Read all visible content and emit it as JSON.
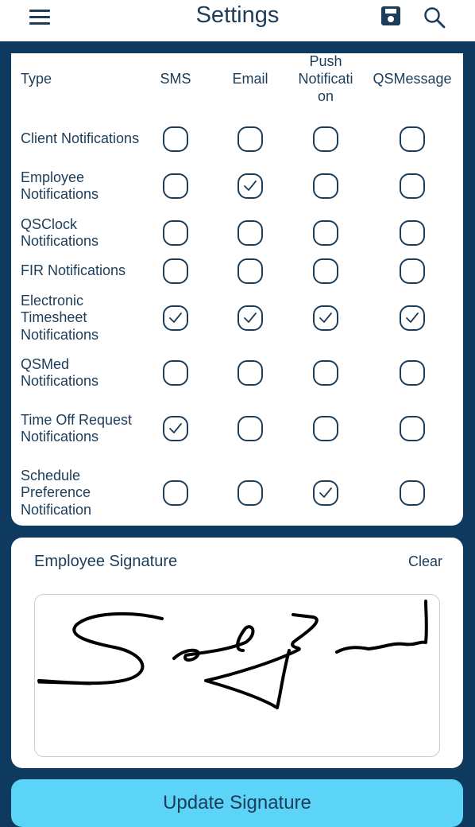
{
  "header": {
    "title": "Settings",
    "menu_icon": "hamburger-icon",
    "save_icon": "save-icon",
    "search_icon": "search-icon"
  },
  "table": {
    "columns": [
      "Type",
      "SMS",
      "Email",
      "Push Notification",
      "QSMessage"
    ],
    "column_display": [
      "Type",
      "SMS",
      "Email",
      "Push\nNotificati\non",
      "QSMessage"
    ],
    "rows": [
      {
        "label": "Client Notifications",
        "checked": [
          false,
          false,
          false,
          false
        ]
      },
      {
        "label": "Employee Notifications",
        "checked": [
          false,
          true,
          false,
          false
        ]
      },
      {
        "label": "QSClock Notifications",
        "checked": [
          false,
          false,
          false,
          false
        ]
      },
      {
        "label": "FIR Notifications",
        "checked": [
          false,
          false,
          false,
          false
        ]
      },
      {
        "label": "Electronic Timesheet Notifications",
        "checked": [
          true,
          true,
          true,
          true
        ]
      },
      {
        "label": "QSMed Notifications",
        "checked": [
          false,
          false,
          false,
          false
        ]
      },
      {
        "label": "Time Off Request Notifications",
        "checked": [
          true,
          false,
          false,
          false
        ]
      },
      {
        "label": "Schedule Preference Notification",
        "checked": [
          false,
          false,
          true,
          false
        ]
      }
    ]
  },
  "signature": {
    "title": "Employee Signature",
    "clear_label": "Clear"
  },
  "update_button": "Update Signature",
  "colors": {
    "background": "#0d3a5e",
    "text": "#1c3d5a",
    "button": "#5cd4f7"
  }
}
